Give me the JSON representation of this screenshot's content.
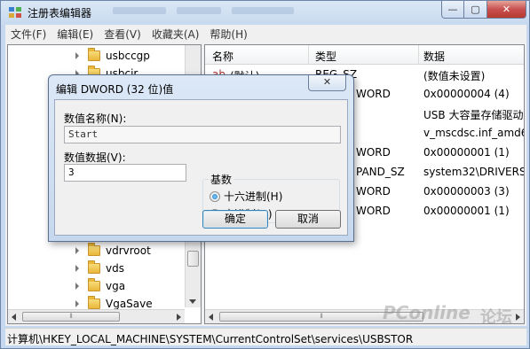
{
  "window": {
    "title": "注册表编辑器",
    "close_glyph": "✕",
    "min_glyph": "—",
    "max_glyph": "▢"
  },
  "menu": [
    "文件(F)",
    "编辑(E)",
    "查看(V)",
    "收藏夹(A)",
    "帮助(H)"
  ],
  "tree": {
    "items": [
      {
        "label": "usbccgp"
      },
      {
        "label": "usbcir"
      },
      {
        "label": "vdrvroot"
      },
      {
        "label": "vds"
      },
      {
        "label": "vga"
      },
      {
        "label": "VgaSave"
      }
    ],
    "scroll_glyph": "⦀"
  },
  "list": {
    "headers": {
      "name": "名称",
      "type": "类型",
      "data": "数据"
    },
    "rows": [
      {
        "name": "(默认)",
        "type": "REG_SZ",
        "data": "(数值未设置)"
      },
      {
        "name": "",
        "type": "WORD",
        "data": "0x00000004 (4)"
      },
      {
        "name": "",
        "type": "",
        "data": "USB 大容量存储驱动"
      },
      {
        "name": "",
        "type": "",
        "data": "v_mscdsc.inf_amd64"
      },
      {
        "name": "",
        "type": "WORD",
        "data": "0x00000001 (1)"
      },
      {
        "name": "",
        "type": "PAND_SZ",
        "data": "system32\\DRIVERS\\"
      },
      {
        "name": "",
        "type": "WORD",
        "data": "0x00000003 (3)"
      },
      {
        "name": "",
        "type": "WORD",
        "data": "0x00000001 (1)"
      }
    ]
  },
  "status": {
    "path": "计算机\\HKEY_LOCAL_MACHINE\\SYSTEM\\CurrentControlSet\\services\\USBSTOR"
  },
  "watermark": {
    "brand": "PConline",
    "suffix": "论坛"
  },
  "dialog": {
    "title": "编辑 DWORD (32 位)值",
    "close_glyph": "✕",
    "value_name_label": "数值名称(N):",
    "value_name": "Start",
    "value_data_label": "数值数据(V):",
    "value_data": "3",
    "base_label": "基数",
    "base_options": [
      {
        "label": "十六进制(H)",
        "selected": true
      },
      {
        "label": "十进制(D)",
        "selected": false
      }
    ],
    "ok_label": "确定",
    "cancel_label": "取消"
  }
}
